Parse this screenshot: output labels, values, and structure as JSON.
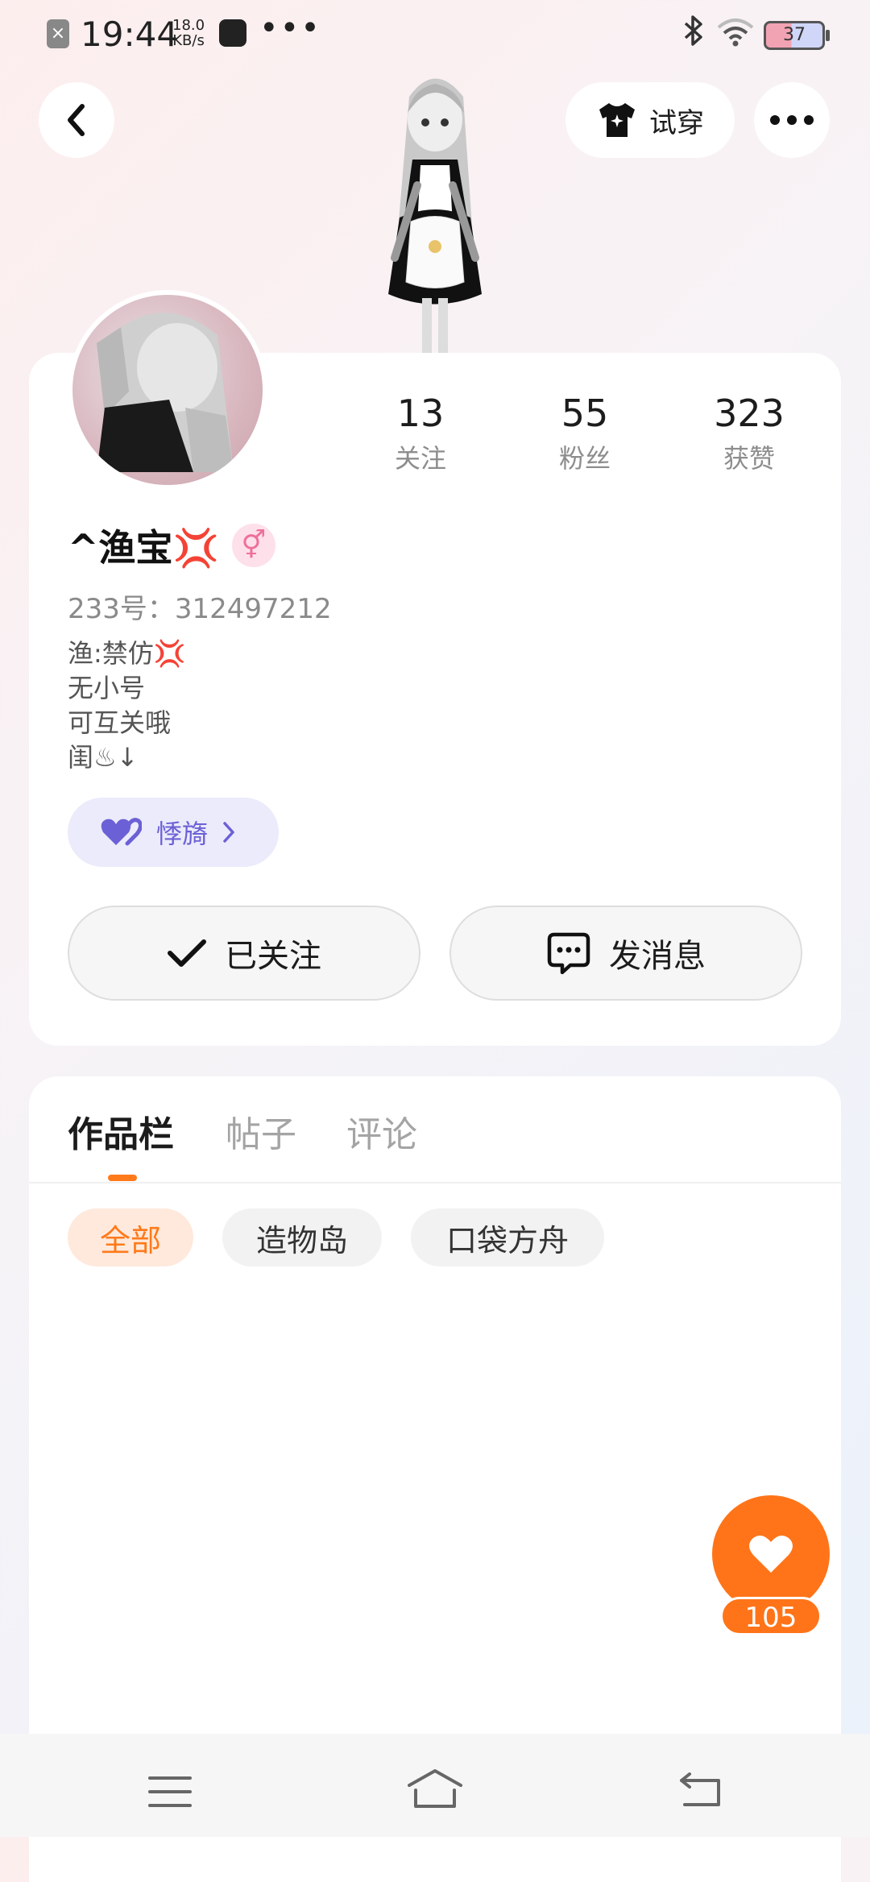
{
  "status_bar": {
    "time": "19:44",
    "speed_value": "18.0",
    "speed_unit": "KB/s",
    "more": "•••",
    "battery": "37"
  },
  "header": {
    "try_on_label": "试穿"
  },
  "profile": {
    "stats": [
      {
        "value": "13",
        "label": "关注"
      },
      {
        "value": "55",
        "label": "粉丝"
      },
      {
        "value": "323",
        "label": "获赞"
      }
    ],
    "username": "^渔宝💢",
    "gender_symbol": "⚥",
    "uid": "233号：312497212",
    "bio": [
      "渔:禁仿💢",
      "无小号",
      "可互关哦",
      "闺♨↓"
    ],
    "badge_label": "悸旖",
    "follow_label": "已关注",
    "message_label": "发消息"
  },
  "tabs": [
    {
      "label": "作品栏",
      "active": true
    },
    {
      "label": "帖子",
      "active": false
    },
    {
      "label": "评论",
      "active": false
    }
  ],
  "filters": [
    {
      "label": "全部",
      "active": true
    },
    {
      "label": "造物岛",
      "active": false
    },
    {
      "label": "口袋方舟",
      "active": false
    }
  ],
  "like": {
    "count": "105"
  },
  "colors": {
    "accent": "#ff7418",
    "badge_purple": "#6c60d6",
    "gender_pink": "#ef6f9a"
  }
}
